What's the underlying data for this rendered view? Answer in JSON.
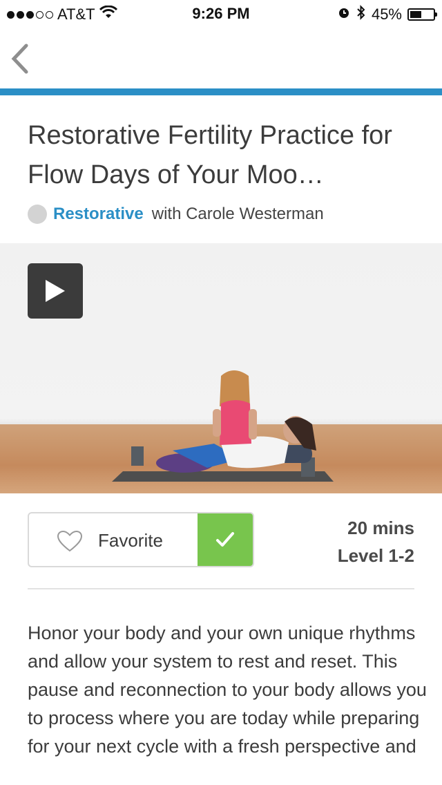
{
  "status_bar": {
    "carrier": "AT&T",
    "time": "9:26 PM",
    "battery": "45%"
  },
  "class": {
    "title": "Restorative Fertility Practice for Flow Days of Your Moo…",
    "category": "Restorative",
    "instructor": "with Carole Westerman",
    "duration": "20 mins",
    "level": "Level 1-2",
    "description": "Honor your body and your own unique rhythms and allow your system to rest and reset. This pause and reconnection to your body allows you to process where you are today while preparing for your next cycle with a fresh perspective and"
  },
  "actions": {
    "favorite_label": "Favorite"
  },
  "colors": {
    "accent": "#2b8fc6",
    "check": "#78c54d",
    "play_button": "#3b3b3b"
  },
  "icons": [
    "back-chevron-icon",
    "play-icon",
    "heart-icon",
    "checkmark-icon",
    "wifi-icon",
    "alarm-icon",
    "bluetooth-icon",
    "battery-icon"
  ]
}
